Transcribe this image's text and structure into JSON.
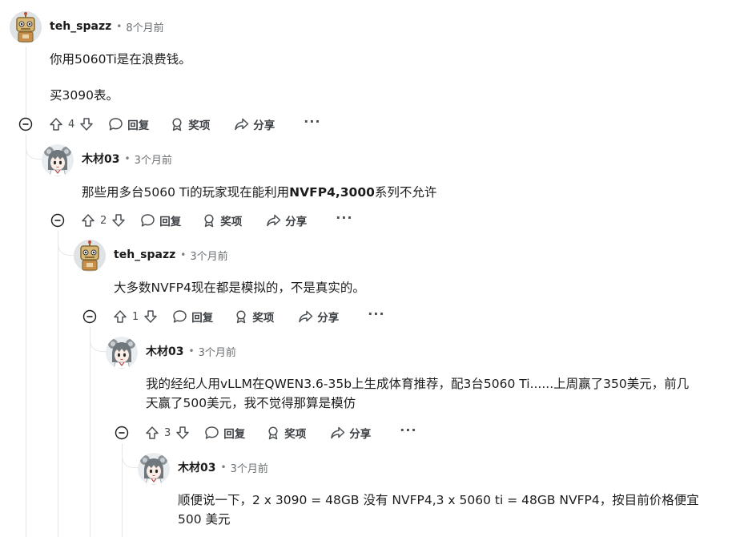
{
  "actions": {
    "reply": "回复",
    "award": "奖项",
    "share": "分享",
    "more": "···"
  },
  "comments": [
    {
      "author": "teh_spazz",
      "separator": "•",
      "time": "8个月前",
      "avatar": "robot-avatar",
      "paragraphs": [
        "你用5060Ti是在浪费钱。",
        "买3090表。"
      ],
      "score": "4"
    },
    {
      "author": "木材03",
      "separator": "•",
      "time": "3个月前",
      "avatar": "anime-girl-avatar",
      "text_before": "那些用多台5060 Ti的玩家现在能利用",
      "text_bold": "NVFP4,3000",
      "text_after": "系列不允许",
      "score": "2"
    },
    {
      "author": "teh_spazz",
      "separator": "•",
      "time": "3个月前",
      "avatar": "robot-avatar",
      "text": "大多数NVFP4现在都是模拟的，不是真实的。",
      "score": "1"
    },
    {
      "author": "木材03",
      "separator": "•",
      "time": "3个月前",
      "avatar": "anime-girl-avatar",
      "lines": [
        "我的经纪人用vLLM在QWEN3.6-35b上生成体育推荐，配3台5060 Ti......上周赢了350美元，前几",
        "天赢了500美元，我不觉得那算是模仿"
      ],
      "score": "3"
    },
    {
      "author": "木材03",
      "separator": "•",
      "time": "3个月前",
      "avatar": "anime-girl-avatar",
      "lines": [
        "顺便说一下，2 x 3090 = 48GB 没有 NVFP4,3 x 5060 ti = 48GB NVFP4，按目前价格便宜",
        "500 美元"
      ]
    }
  ],
  "colors": {
    "thread_line": "#e4e6e8",
    "text": "#1c1c1c",
    "meta": "#6a6f73",
    "icon": "#4a4f53"
  }
}
